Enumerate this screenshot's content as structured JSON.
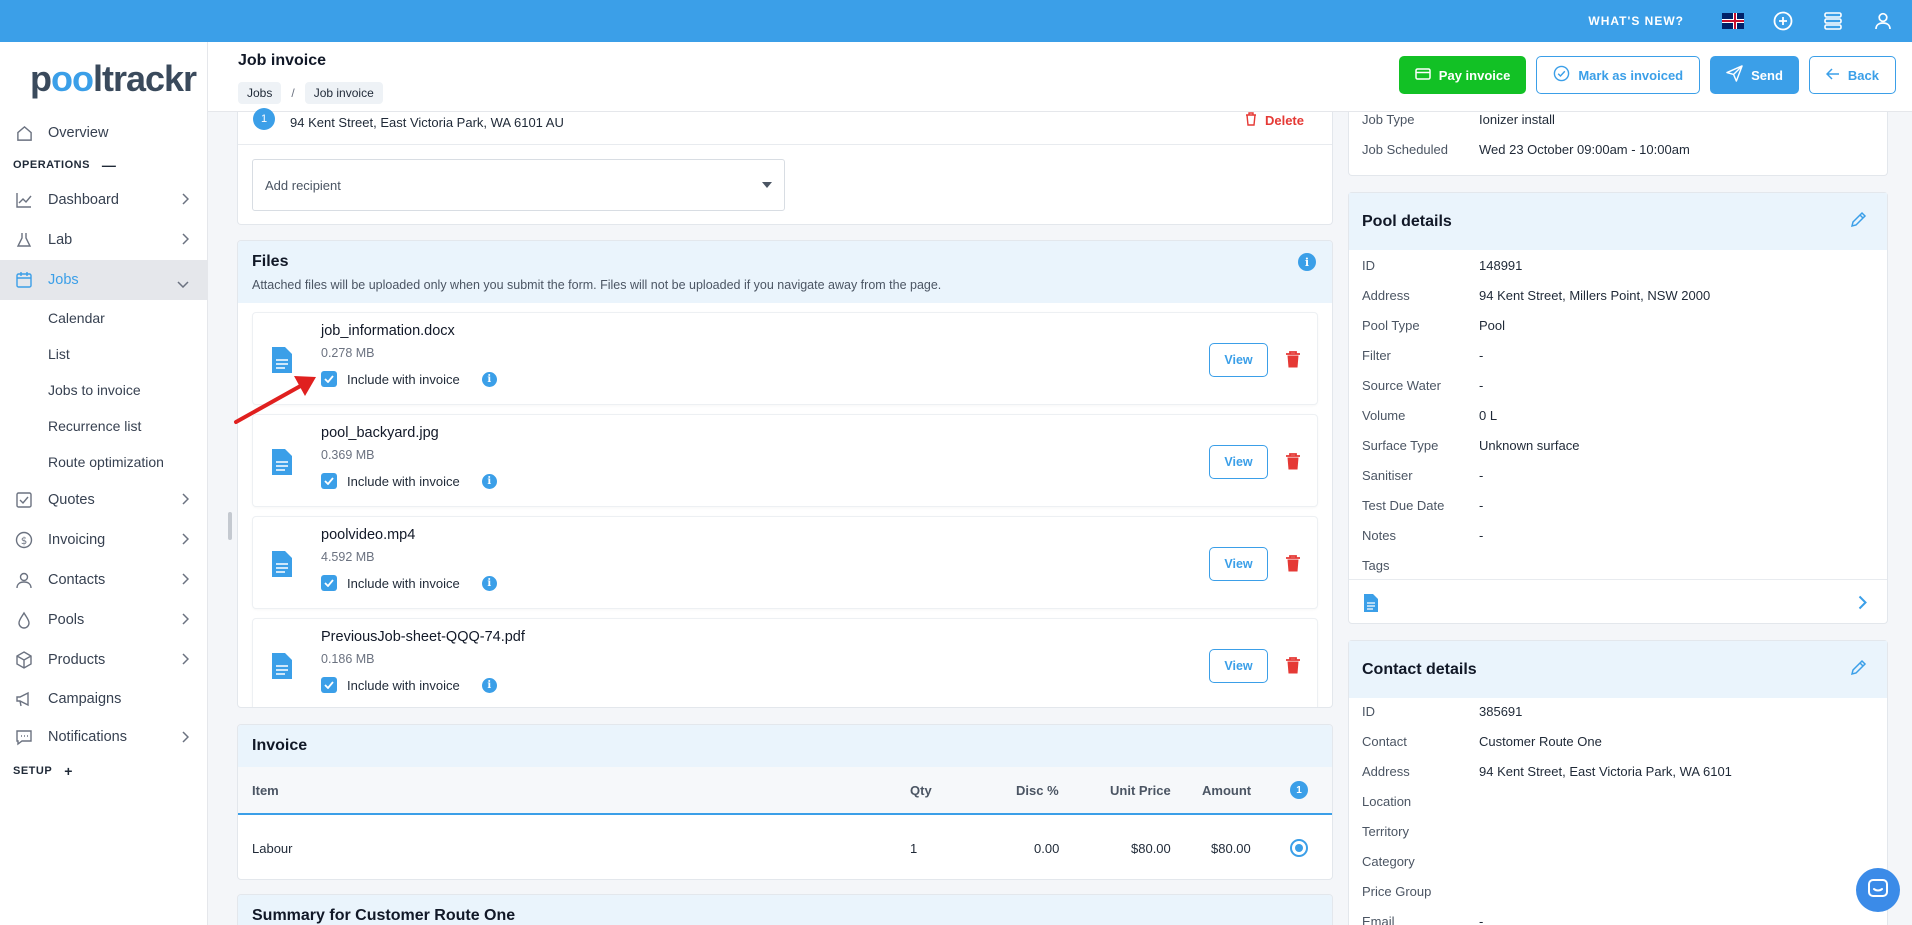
{
  "topbar": {
    "whats_new": "WHAT'S NEW?"
  },
  "brand": {
    "logo_text_a": "p",
    "logo_text_o": "oo",
    "logo_text_b": "ltrackr"
  },
  "sidebar": {
    "overview": "Overview",
    "operations_label": "OPERATIONS",
    "operations_mark": "—",
    "items": {
      "dashboard": "Dashboard",
      "lab": "Lab",
      "jobs": "Jobs",
      "calendar": "Calendar",
      "list": "List",
      "jobs_to_invoice": "Jobs to invoice",
      "recurrence_list": "Recurrence list",
      "route_optimization": "Route optimization",
      "quotes": "Quotes",
      "invoicing": "Invoicing",
      "contacts": "Contacts",
      "pools": "Pools",
      "products": "Products",
      "campaigns": "Campaigns",
      "notifications": "Notifications"
    },
    "setup_label": "SETUP",
    "setup_mark": "+"
  },
  "header": {
    "title": "Job invoice",
    "crumbs": [
      "Jobs",
      "Job invoice"
    ],
    "crumb_sep": "/",
    "buttons": {
      "pay": "Pay invoice",
      "mark": "Mark as invoiced",
      "send": "Send",
      "back": "Back"
    }
  },
  "recipient": {
    "step": "1",
    "address": "94 Kent Street, East Victoria Park, WA 6101 AU",
    "delete_label": "Delete",
    "add_placeholder": "Add recipient"
  },
  "files": {
    "title": "Files",
    "description": "Attached files will be uploaded only when you submit the form. Files will not be uploaded if you navigate away from the page.",
    "info": "i",
    "include_label": "Include with invoice",
    "view_label": "View",
    "items": [
      {
        "name": "job_information.docx",
        "size": "0.278 MB",
        "included": true
      },
      {
        "name": "pool_backyard.jpg",
        "size": "0.369 MB",
        "included": true
      },
      {
        "name": "poolvideo.mp4",
        "size": "4.592 MB",
        "included": true
      },
      {
        "name": "PreviousJob-sheet-QQQ-74.pdf",
        "size": "0.186 MB",
        "included": true
      }
    ]
  },
  "invoice": {
    "title": "Invoice",
    "columns": {
      "item": "Item",
      "qty": "Qty",
      "disc": "Disc %",
      "unit_price": "Unit Price",
      "amount": "Amount",
      "count": "1"
    },
    "rows": [
      {
        "item": "Labour",
        "qty": "1",
        "disc": "0.00",
        "unit_price": "$80.00",
        "amount": "$80.00"
      }
    ]
  },
  "summary": {
    "title": "Summary for Customer Route One"
  },
  "job_details": {
    "rows": [
      {
        "k": "Job Type",
        "v": "Ionizer install"
      },
      {
        "k": "Job Scheduled",
        "v": "Wed 23 October 09:00am - 10:00am"
      }
    ]
  },
  "pool_details": {
    "title": "Pool details",
    "rows": [
      {
        "k": "ID",
        "v": "148991"
      },
      {
        "k": "Address",
        "v": "94 Kent Street, Millers Point, NSW 2000"
      },
      {
        "k": "Pool Type",
        "v": "Pool"
      },
      {
        "k": "Filter",
        "v": "-"
      },
      {
        "k": "Source Water",
        "v": "-"
      },
      {
        "k": "Volume",
        "v": "0 L"
      },
      {
        "k": "Surface Type",
        "v": "Unknown surface"
      },
      {
        "k": "Sanitiser",
        "v": "-"
      },
      {
        "k": "Test Due Date",
        "v": "-"
      },
      {
        "k": "Notes",
        "v": "-"
      },
      {
        "k": "Tags",
        "v": ""
      }
    ]
  },
  "contact_details": {
    "title": "Contact details",
    "rows": [
      {
        "k": "ID",
        "v": "385691"
      },
      {
        "k": "Contact",
        "v": "Customer Route One"
      },
      {
        "k": "Address",
        "v": "94 Kent Street, East Victoria Park, WA 6101"
      },
      {
        "k": "Location",
        "v": ""
      },
      {
        "k": "Territory",
        "v": ""
      },
      {
        "k": "Category",
        "v": ""
      },
      {
        "k": "Price Group",
        "v": ""
      },
      {
        "k": "Email",
        "v": "-"
      }
    ]
  },
  "colors": {
    "accent": "#3b9fe8",
    "pay_green": "#12c125",
    "danger": "#e53935",
    "annotation_arrow": "#e0201f"
  }
}
